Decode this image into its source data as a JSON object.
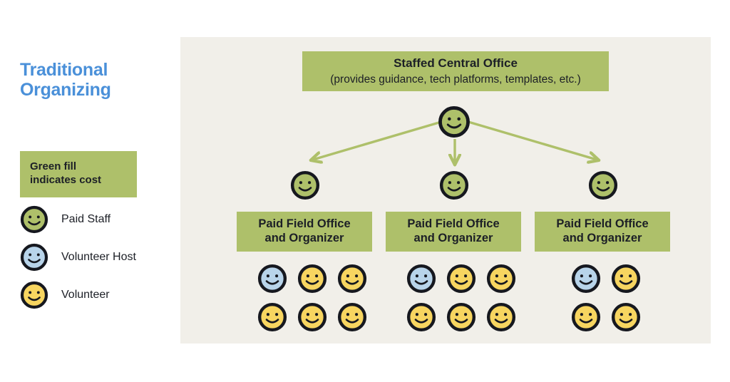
{
  "title": {
    "line1": "Traditional",
    "line2": "Organizing",
    "color": "#4a90d9"
  },
  "cost_note": {
    "line1": "Green fill",
    "line2": "indicates cost",
    "fill": "#aec06a"
  },
  "legend": {
    "items": [
      {
        "label": "Paid Staff",
        "icon": "smiley-face-icon",
        "fill": "#aec06a"
      },
      {
        "label": "Volunteer Host",
        "icon": "smiley-face-icon",
        "fill": "#b8d4ea"
      },
      {
        "label": "Volunteer",
        "icon": "smiley-face-icon",
        "fill": "#f7d560"
      }
    ]
  },
  "diagram": {
    "background": "#f1efe9",
    "central_office": {
      "title": "Staffed Central Office",
      "subtitle": "(provides guidance, tech platforms, templates, etc.)",
      "fill": "#aec06a"
    },
    "root_node": {
      "icon": "smiley-face-icon",
      "fill": "#aec06a",
      "role": "Paid Staff"
    },
    "branches": [
      {
        "node": {
          "icon": "smiley-face-icon",
          "fill": "#aec06a",
          "role": "Paid Staff"
        },
        "box": {
          "line1": "Paid Field Office",
          "line2": "and Organizer",
          "fill": "#aec06a"
        },
        "people": [
          {
            "icon": "smiley-face-icon",
            "fill": "#b8d4ea",
            "role": "Volunteer Host"
          },
          {
            "icon": "smiley-face-icon",
            "fill": "#f7d560",
            "role": "Volunteer"
          },
          {
            "icon": "smiley-face-icon",
            "fill": "#f7d560",
            "role": "Volunteer"
          },
          {
            "icon": "smiley-face-icon",
            "fill": "#f7d560",
            "role": "Volunteer"
          },
          {
            "icon": "smiley-face-icon",
            "fill": "#f7d560",
            "role": "Volunteer"
          },
          {
            "icon": "smiley-face-icon",
            "fill": "#f7d560",
            "role": "Volunteer"
          }
        ]
      },
      {
        "node": {
          "icon": "smiley-face-icon",
          "fill": "#aec06a",
          "role": "Paid Staff"
        },
        "box": {
          "line1": "Paid Field Office",
          "line2": "and Organizer",
          "fill": "#aec06a"
        },
        "people": [
          {
            "icon": "smiley-face-icon",
            "fill": "#b8d4ea",
            "role": "Volunteer Host"
          },
          {
            "icon": "smiley-face-icon",
            "fill": "#f7d560",
            "role": "Volunteer"
          },
          {
            "icon": "smiley-face-icon",
            "fill": "#f7d560",
            "role": "Volunteer"
          },
          {
            "icon": "smiley-face-icon",
            "fill": "#f7d560",
            "role": "Volunteer"
          },
          {
            "icon": "smiley-face-icon",
            "fill": "#f7d560",
            "role": "Volunteer"
          },
          {
            "icon": "smiley-face-icon",
            "fill": "#f7d560",
            "role": "Volunteer"
          }
        ]
      },
      {
        "node": {
          "icon": "smiley-face-icon",
          "fill": "#aec06a",
          "role": "Paid Staff"
        },
        "box": {
          "line1": "Paid Field Office",
          "line2": "and Organizer",
          "fill": "#aec06a"
        },
        "people": [
          {
            "icon": "smiley-face-icon",
            "fill": "#b8d4ea",
            "role": "Volunteer Host"
          },
          {
            "icon": "smiley-face-icon",
            "fill": "#f7d560",
            "role": "Volunteer"
          },
          {
            "icon": "smiley-face-icon",
            "fill": "#f7d560",
            "role": "Volunteer"
          },
          {
            "icon": "smiley-face-icon",
            "fill": "#f7d560",
            "role": "Volunteer"
          }
        ]
      }
    ],
    "arrow_color": "#aec06a"
  }
}
